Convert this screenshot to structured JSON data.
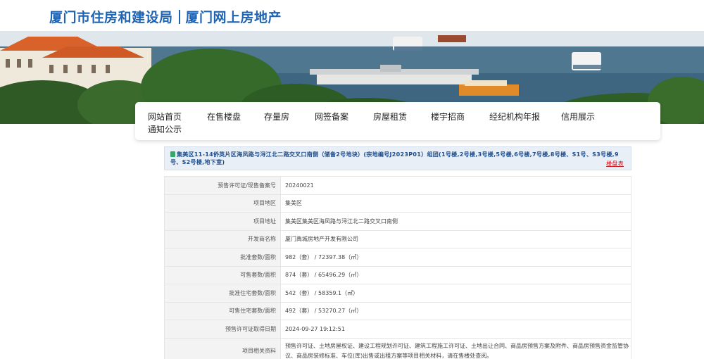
{
  "header": {
    "title_left": "厦门市住房和建设局",
    "title_right": "厦门网上房地产"
  },
  "nav": {
    "items": [
      "网站首页",
      "在售楼盘",
      "存量房",
      "网签备案",
      "房屋租赁",
      "楼宇招商",
      "经纪机构年报",
      "信用展示"
    ],
    "items_row2": [
      "通知公示"
    ]
  },
  "project": {
    "title": "集美区11-14侨英片区海凤路与浔江北二路交叉口南侧（储备2号地块）(宗地编号J2023P01）组团(1号楼,2号楼,3号楼,5号楼,6号楼,7号楼,8号楼、S1号、S3号楼,9号、S2号楼,地下室)",
    "link_label": "楼盘表"
  },
  "details": [
    {
      "key": "预售许可证/现售备案号",
      "value": "20240021"
    },
    {
      "key": "项目地区",
      "value": "集美区"
    },
    {
      "key": "项目地址",
      "value": "集美区集美区海凤路与浔江北二路交叉口南侧"
    },
    {
      "key": "开发商名称",
      "value": "厦门禹城房地产开发有限公司"
    },
    {
      "key": "批准套数/面积",
      "value": "982（套） / 72397.38（㎡）"
    },
    {
      "key": "可售套数/面积",
      "value": "874（套） / 65496.29（㎡）"
    },
    {
      "key": "批准住宅套数/面积",
      "value": "542（套） / 58359.1（㎡）"
    },
    {
      "key": "可售住宅套数/面积",
      "value": "492（套） / 53270.27（㎡）"
    },
    {
      "key": "预售许可证取得日期",
      "value": "2024-09-27 19:12:51"
    },
    {
      "key": "项目相关资料",
      "value": "预售许可证、土地房屋权证、建设工程规划许可证、建筑工程施工许可证、土地出让合同、商品房预售方案及附件、商品房预售资金监管协议、商品房装修标准、车位(库)出售或出租方案等项目相关材料，请在售楼处查阅。"
    }
  ],
  "colors": {
    "brand_blue": "#1f63b3",
    "title_bg": "#e9eff6",
    "link_red": "#d2161e"
  }
}
